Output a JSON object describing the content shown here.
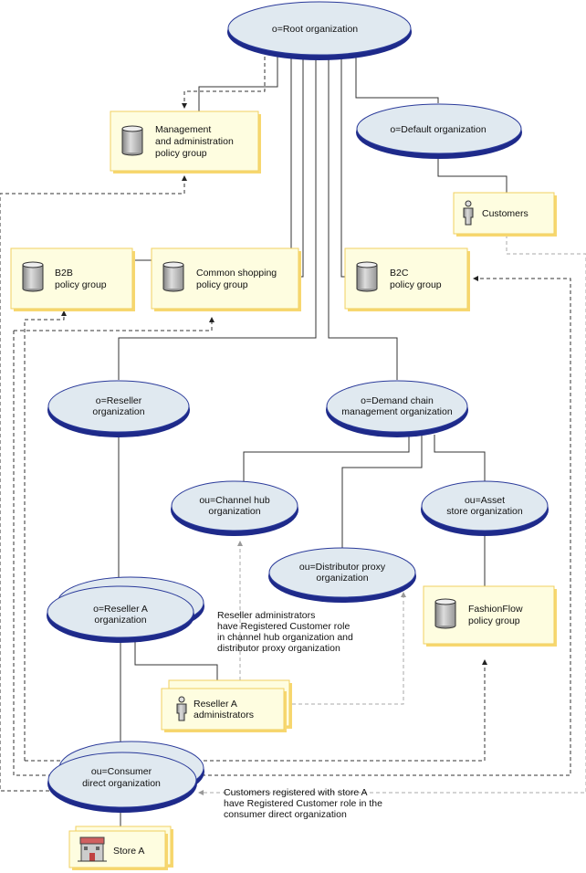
{
  "nodes": {
    "root": [
      "o=Root organization"
    ],
    "default_org": [
      "o=Default organization"
    ],
    "mgmt": [
      "Management",
      "and administration",
      "policy group"
    ],
    "customers": [
      "Customers"
    ],
    "b2b": [
      "B2B",
      "policy group"
    ],
    "common": [
      "Common shopping",
      "policy group"
    ],
    "b2c": [
      "B2C",
      "policy group"
    ],
    "reseller": [
      "o=Reseller",
      "organization"
    ],
    "demand": [
      "o=Demand chain",
      "management organization"
    ],
    "channel": [
      "ou=Channel hub",
      "organization"
    ],
    "asset": [
      "ou=Asset",
      "store organization"
    ],
    "distributor": [
      "ou=Distributor proxy",
      "organization"
    ],
    "reseller_a": [
      "o=Reseller A",
      "organization"
    ],
    "fashionflow": [
      "FashionFlow",
      "policy group"
    ],
    "reseller_admins": [
      "Reseller A",
      "administrators"
    ],
    "consumer": [
      "ou=Consumer",
      "direct organization"
    ],
    "store": [
      "Store A"
    ]
  },
  "notes": {
    "reseller_note": [
      "Reseller administrators",
      "have Registered Customer role",
      "in channel hub organization and",
      "distributor proxy organization"
    ],
    "customer_note": [
      "Customers registered with store A",
      "have Registered Customer role in the",
      "consumer direct organization"
    ]
  },
  "icons": {
    "policy_group": "database-cylinder-icon",
    "user_group": "person-icon",
    "store": "store-building-icon"
  },
  "colors": {
    "org_fill": "#e0e9f0",
    "org_edge": "#1e2a8a",
    "box_fill": "#fefde0",
    "box_shadow": "#f7d770"
  }
}
